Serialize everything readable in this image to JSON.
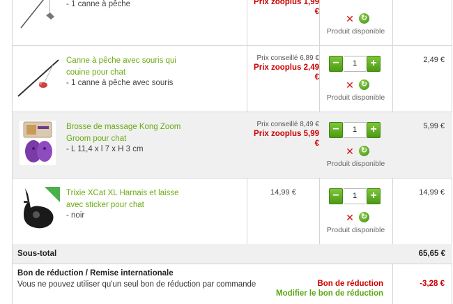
{
  "items": [
    {
      "name": "",
      "variant": "- 1 canne à pêche",
      "price_regular": "",
      "price_zooplus": "Prix zooplus 1,99 €",
      "price_plain": "",
      "quantity": "",
      "availability": "Produit disponible",
      "total": "",
      "thumb_icon": "fishing-rod-toy"
    },
    {
      "name": "Canne à pêche avec souris qui couine pour chat",
      "variant": "- 1 canne à pêche avec souris",
      "price_regular": "Prix conseillé 6,89 €",
      "price_zooplus": "Prix zooplus 2,49 €",
      "price_plain": "",
      "quantity": "1",
      "availability": "Produit disponible",
      "total": "2,49 €",
      "thumb_icon": "fishing-rod-mouse-toy"
    },
    {
      "name": "Brosse de massage Kong Zoom Groom pour chat",
      "variant": "- L 11,4 x l 7 x H 3 cm",
      "price_regular": "Prix conseillé 8,49 €",
      "price_zooplus": "Prix zooplus 5,99 €",
      "price_plain": "",
      "quantity": "1",
      "availability": "Produit disponible",
      "total": "5,99 €",
      "thumb_icon": "kong-zoom-groom-brush"
    },
    {
      "name": "Trixie XCat XL Harnais et laisse avec sticker pour chat",
      "variant": "- noir",
      "price_regular": "",
      "price_zooplus": "",
      "price_plain": "14,99 €",
      "quantity": "1",
      "availability": "Produit disponible",
      "total": "14,99 €",
      "thumb_icon": "cat-harness"
    }
  ],
  "buttons": {
    "minus": "−",
    "plus": "+",
    "remove": "✕",
    "refresh": "↻"
  },
  "subtotal": {
    "label": "Sous-total",
    "value": "65,65 €"
  },
  "coupon": {
    "title": "Bon de réduction  /  Remise internationale",
    "note": "Vous ne pouvez utiliser qu'un seul bon de réduction par commande",
    "label": "Bon de réduction",
    "value": "-3,28 €",
    "modify_link": "Modifier le bon de réduction"
  },
  "colors": {
    "product_link": "#6aab12",
    "price_red": "#cc0000",
    "button_green": "#5aa012",
    "row_alt_bg": "#f0f0f0"
  }
}
